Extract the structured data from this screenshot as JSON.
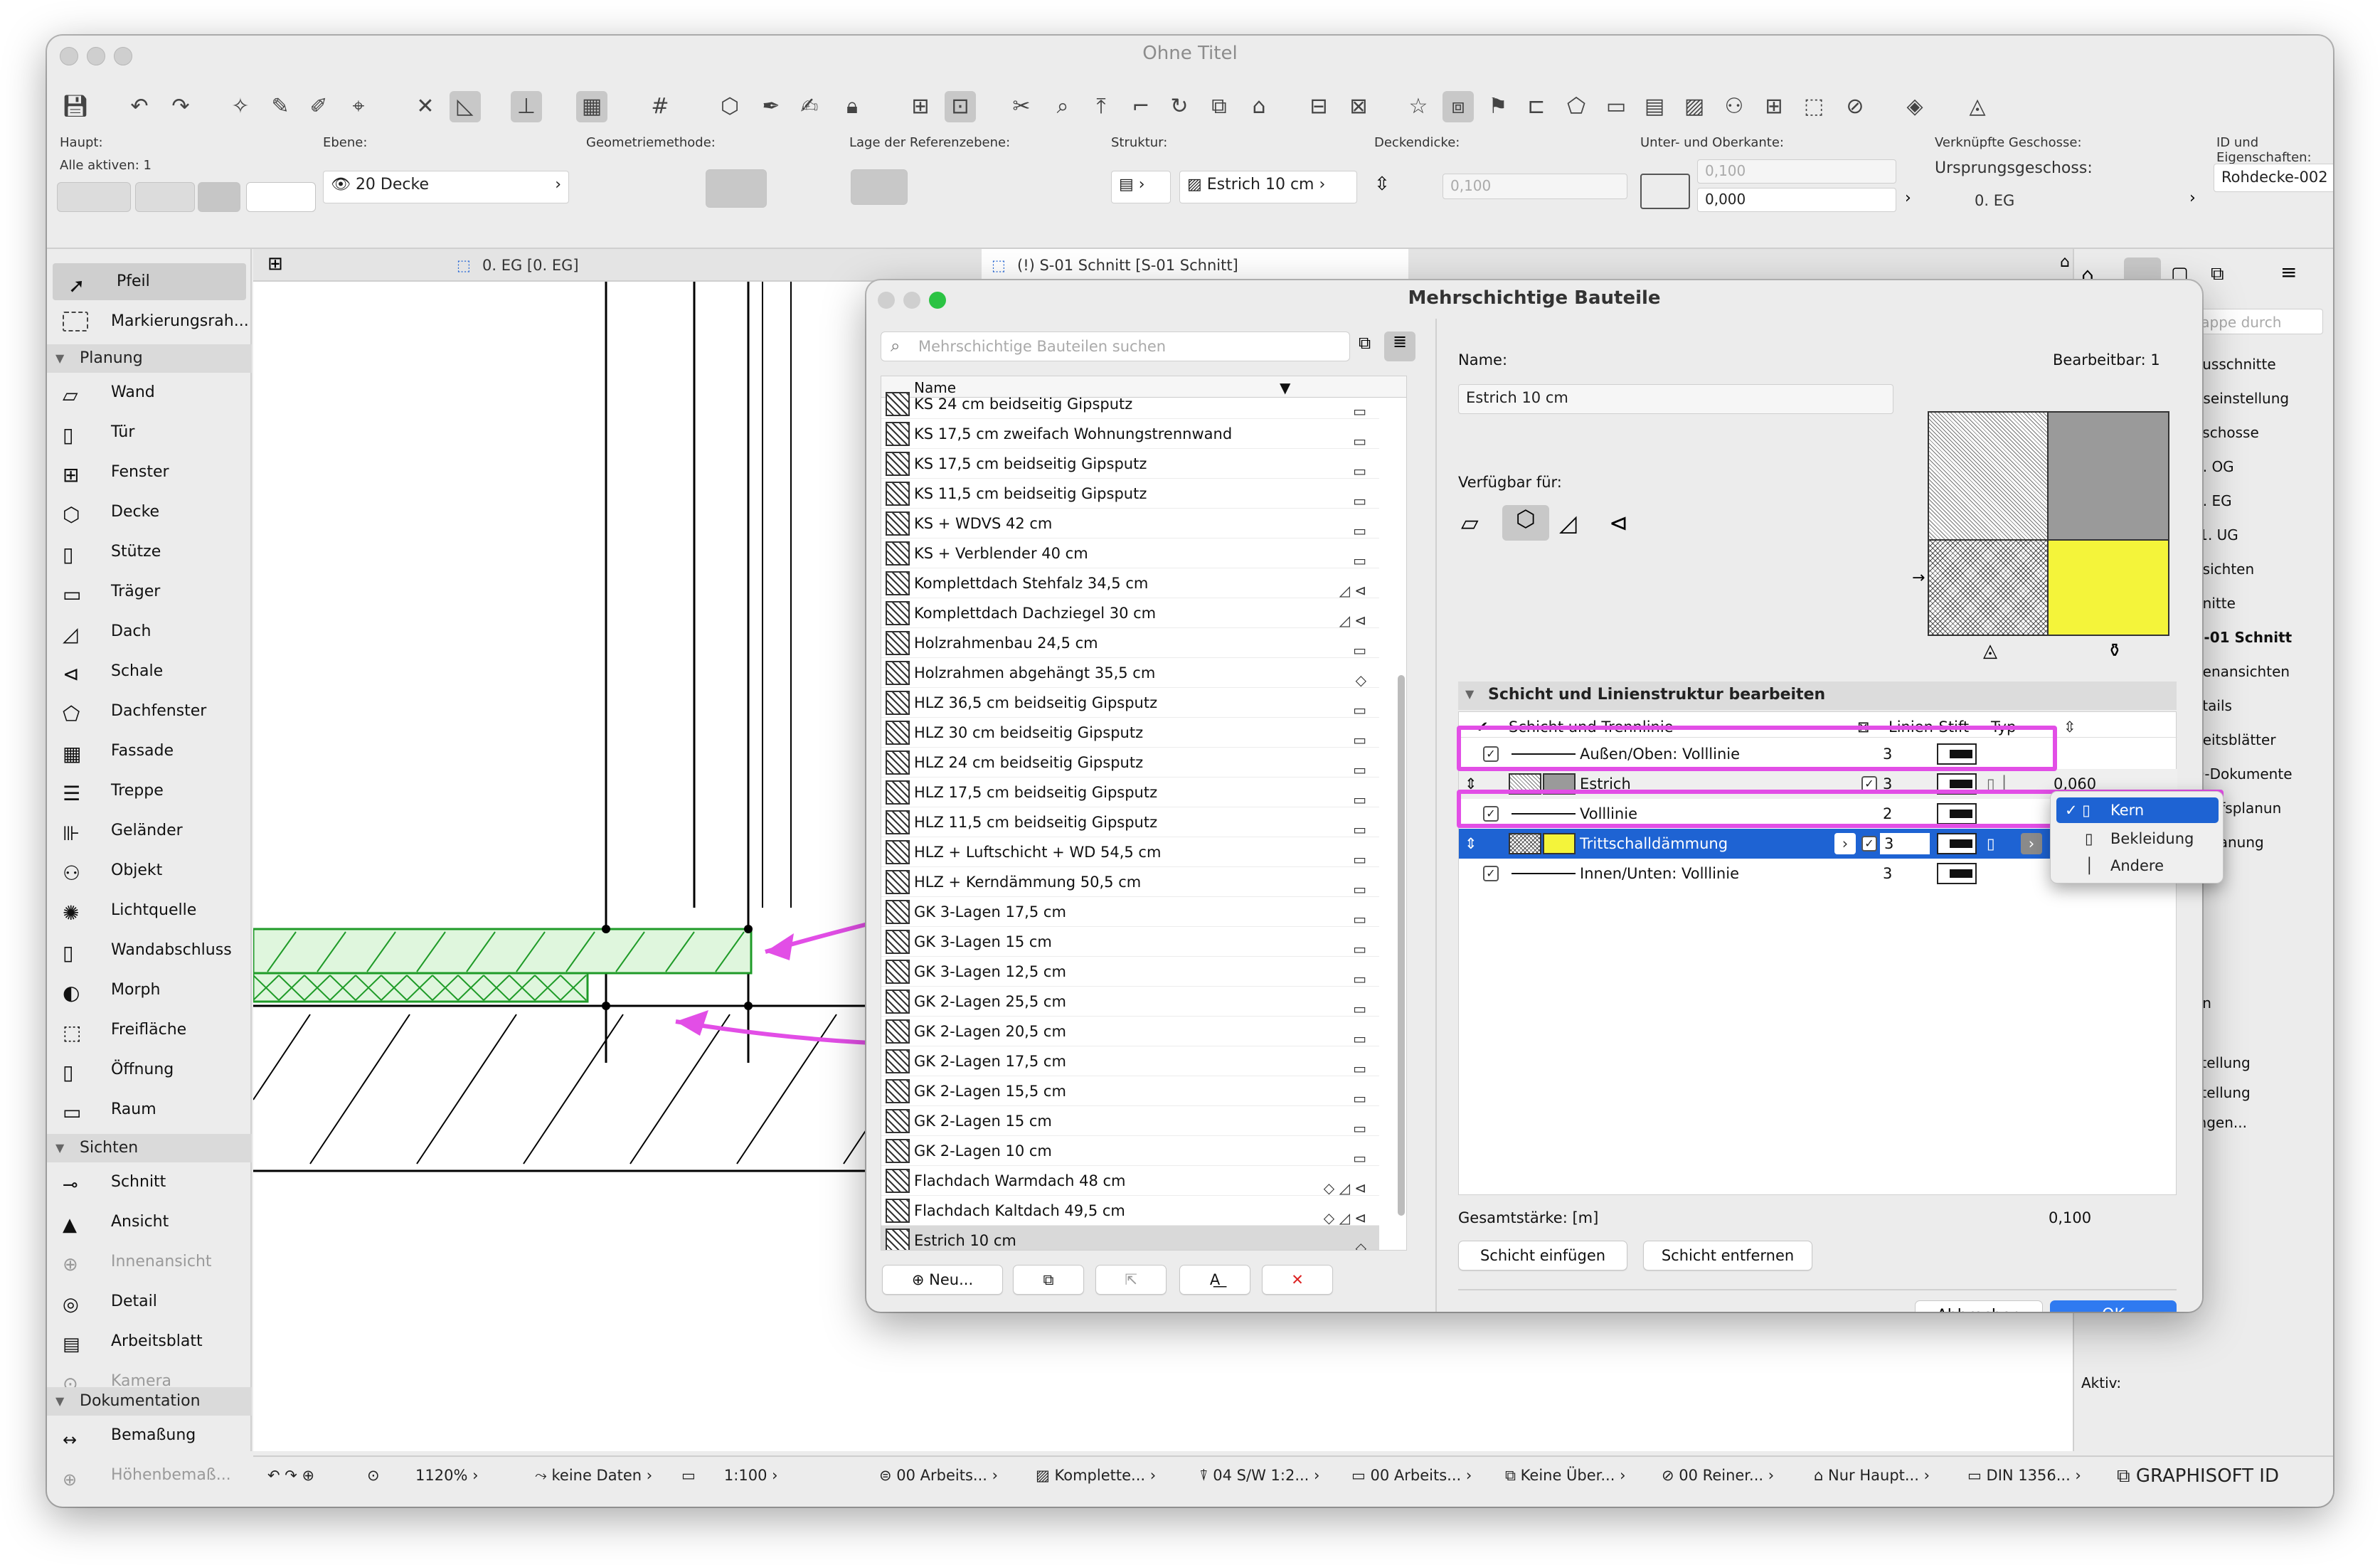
{
  "app": {
    "title": "Ohne Titel",
    "graphisoft_label": "GRAPHISOFT ID"
  },
  "infobox": {
    "haupt_label": "Haupt:",
    "alle_aktiven": "Alle aktiven: 1",
    "ebene_label": "Ebene:",
    "ebene_value": "20 Decke",
    "geometrie_label": "Geometriemethode:",
    "lage_label": "Lage der Referenzebene:",
    "struktur_label": "Struktur:",
    "struktur_value": "Estrich 10 cm",
    "deckendicke_label": "Deckendicke:",
    "deckendicke_value": "0,100",
    "unter_ober_label": "Unter- und Oberkante:",
    "oberkante": "0,100",
    "unterkante": "0,000",
    "geschosse_label": "Verknüpfte Geschosse:",
    "ursprung_label": "Ursprungsgeschoss:",
    "ursprung_value": "0. EG",
    "id_label": "ID und Eigenschaften:",
    "id_value": "Rohdecke-002"
  },
  "tabs": [
    {
      "label": "0. EG [0. EG]"
    },
    {
      "label": "(!) S-01 Schnitt [S-01 Schnitt]"
    }
  ],
  "sidebar": {
    "top": [
      "Pfeil",
      "Markierungsrah..."
    ],
    "planung_label": "Planung",
    "planung": [
      "Wand",
      "Tür",
      "Fenster",
      "Decke",
      "Stütze",
      "Träger",
      "Dach",
      "Schale",
      "Dachfenster",
      "Fassade",
      "Treppe",
      "Geländer",
      "Objekt",
      "Lichtquelle",
      "Wandabschluss",
      "Morph",
      "Freifläche",
      "Öffnung",
      "Raum"
    ],
    "sichten_label": "Sichten",
    "sichten": [
      "Schnitt",
      "Ansicht",
      "Innenansicht",
      "Detail",
      "Arbeitsblatt",
      "Kamera"
    ],
    "doku_label": "Dokumentation",
    "doku": [
      "Bemaßung",
      "Höhenbemaß..."
    ]
  },
  "navigator": {
    "search_placeholder": "Mappe durch",
    "items": [
      "ausschnitte",
      "itseinstellung",
      "eschosse",
      "1. OG",
      "0. EG",
      "-1. UG",
      "nsichten",
      "hnitte",
      "S-01 Schnitt",
      "nenansichten",
      "etails",
      "beitsblätter",
      "D-Dokumente",
      "wurfsplanun",
      "fsplanung"
    ],
    "lower": [
      "en",
      "t",
      "stellung",
      "stellung",
      "ingen..."
    ],
    "aktiv_label": "Aktiv:"
  },
  "status": {
    "zoom": "1120%",
    "keine_daten": "keine Daten",
    "scale": "1:100",
    "items": [
      "00 Arbeits...",
      "Komplette...",
      "04 S/W 1:2...",
      "00 Arbeits...",
      "Keine Über...",
      "00 Reiner...",
      "Nur Haupt...",
      "DIN 1356..."
    ]
  },
  "dialog": {
    "title": "Mehrschichtige Bauteile",
    "search_placeholder": "Mehrschichtige Bauteilen suchen",
    "column_name": "Name",
    "rows": [
      {
        "name": "KS 24 cm beidseitig Gipsputz",
        "av": "▭"
      },
      {
        "name": "KS 17,5 cm zweifach Wohnungstrennwand",
        "av": "▭"
      },
      {
        "name": "KS 17,5 cm beidseitig Gipsputz",
        "av": "▭"
      },
      {
        "name": "KS 11,5 cm beidseitig Gipsputz",
        "av": "▭"
      },
      {
        "name": "KS + WDVS 42 cm",
        "av": "▭"
      },
      {
        "name": "KS + Verblender 40 cm",
        "av": "▭"
      },
      {
        "name": "Komplettdach Stehfalz 34,5 cm",
        "av": "◿ ⊲"
      },
      {
        "name": "Komplettdach Dachziegel 30 cm",
        "av": "◿ ⊲"
      },
      {
        "name": "Holzrahmenbau 24,5 cm",
        "av": "▭"
      },
      {
        "name": "Holzrahmen abgehängt 35,5 cm",
        "av": "◇"
      },
      {
        "name": "HLZ 36,5 cm beidseitig Gipsputz",
        "av": "▭"
      },
      {
        "name": "HLZ 30 cm beidseitig Gipsputz",
        "av": "▭"
      },
      {
        "name": "HLZ 24 cm beidseitig Gipsputz",
        "av": "▭"
      },
      {
        "name": "HLZ 17,5 cm beidseitig Gipsputz",
        "av": "▭"
      },
      {
        "name": "HLZ 11,5 cm beidseitig Gipsputz",
        "av": "▭"
      },
      {
        "name": "HLZ + Luftschicht + WD 54,5 cm",
        "av": "▭"
      },
      {
        "name": "HLZ + Kerndämmung 50,5 cm",
        "av": "▭"
      },
      {
        "name": "GK 3-Lagen 17,5 cm",
        "av": "▭"
      },
      {
        "name": "GK 3-Lagen 15 cm",
        "av": "▭"
      },
      {
        "name": "GK 3-Lagen 12,5 cm",
        "av": "▭"
      },
      {
        "name": "GK 2-Lagen 25,5 cm",
        "av": "▭"
      },
      {
        "name": "GK 2-Lagen 20,5 cm",
        "av": "▭"
      },
      {
        "name": "GK 2-Lagen 17,5 cm",
        "av": "▭"
      },
      {
        "name": "GK 2-Lagen 15,5 cm",
        "av": "▭"
      },
      {
        "name": "GK 2-Lagen 15 cm",
        "av": "▭"
      },
      {
        "name": "GK 2-Lagen 10 cm",
        "av": "▭"
      },
      {
        "name": "Flachdach Warmdach 48 cm",
        "av": "◇ ◿ ⊲"
      },
      {
        "name": "Flachdach Kaltdach 49,5 cm",
        "av": "◇ ◿ ⊲"
      },
      {
        "name": "Estrich 10 cm",
        "av": "◇"
      }
    ],
    "new_button": "Neu...",
    "name_label": "Name:",
    "name_value": "Estrich 10 cm",
    "bearbeitbar": "Bearbeitbar: 1",
    "verfuegbar_label": "Verfügbar für:",
    "section_title": "Schicht und Linienstruktur bearbeiten",
    "table_head": {
      "col1": "Schicht und Trennlinie",
      "col2": "Linien-Stift",
      "col3": "Typ"
    },
    "layers": [
      {
        "name": "Außen/Oben: Volllinie",
        "pen": "3",
        "kind": "line"
      },
      {
        "name": "Estrich",
        "pen": "3",
        "kind": "layer",
        "thick": "0,060",
        "color": "#9a9a9a"
      },
      {
        "name": "Volllinie",
        "pen": "2",
        "kind": "line"
      },
      {
        "name": "Trittschalldämmung",
        "pen": "3",
        "kind": "layer",
        "color": "#f4f43a"
      },
      {
        "name": "Innen/Unten: Volllinie",
        "pen": "3",
        "kind": "line"
      }
    ],
    "gesamt_label": "Gesamtstärke: [m]",
    "gesamt_value": "0,100",
    "insert_button": "Schicht einfügen",
    "remove_button": "Schicht entfernen",
    "cancel_button": "Abbrechen",
    "ok_button": "OK",
    "dropdown": [
      "Kern",
      "Bekleidung",
      "Andere"
    ]
  },
  "colors": {
    "accent": "#1e63d3",
    "annotation": "#e24ee6",
    "insulation": "#f4f43a",
    "green": "#dff6dd"
  }
}
